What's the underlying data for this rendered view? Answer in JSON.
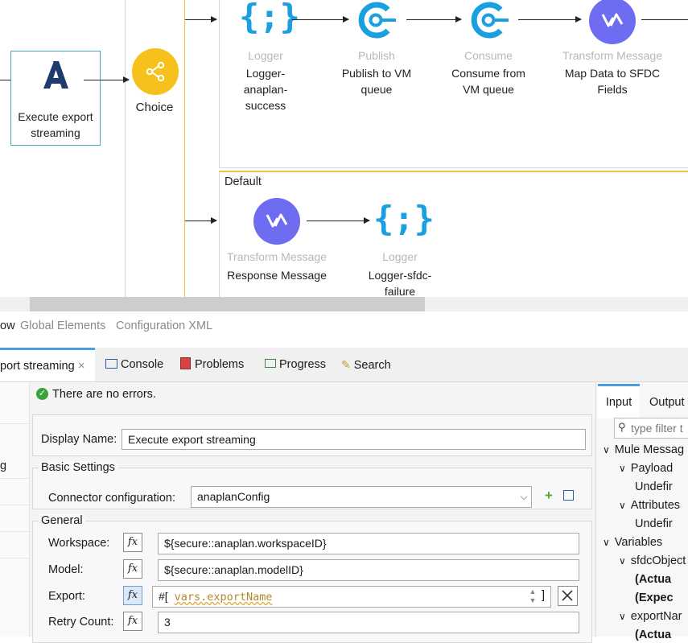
{
  "flow": {
    "source_node": {
      "label": "Execute export streaming"
    },
    "choice_node": {
      "label": "Choice"
    },
    "default_route": {
      "label": "Default"
    },
    "route1": [
      {
        "type": "Logger",
        "label": "Logger-anaplan-success"
      },
      {
        "type": "Publish",
        "label": "Publish to VM queue"
      },
      {
        "type": "Consume",
        "label": "Consume from VM queue"
      },
      {
        "type": "Transform Message",
        "label": "Map Data to SFDC Fields"
      }
    ],
    "route2": [
      {
        "type": "Transform Message",
        "label": "Response Message"
      },
      {
        "type": "Logger",
        "label": "Logger-sfdc-failure"
      }
    ],
    "icons": {
      "logger": "{;}",
      "accent_blue": "#1a9fe0",
      "accent_purple": "#6e6cf0",
      "accent_yellow": "#f5c11a",
      "anaplan_navy": "#1f3a6e"
    }
  },
  "editor_tabs": [
    "ow",
    "Global Elements",
    "Configuration XML"
  ],
  "view_tabs": {
    "active": "port streaming",
    "close": "×",
    "items": [
      "Console",
      "Problems",
      "Progress",
      "Search"
    ]
  },
  "left_stub": {
    "item": "g"
  },
  "props": {
    "status": "There are no errors.",
    "display_name_label": "Display Name:",
    "display_name_value": "Execute export streaming",
    "basic_settings_label": "Basic Settings",
    "connector_label": "Connector configuration:",
    "connector_value": "anaplanConfig",
    "general_label": "General",
    "fields": [
      {
        "label": "Workspace:",
        "value": "${secure::anaplan.workspaceID}"
      },
      {
        "label": "Model:",
        "value": "${secure::anaplan.modelID}"
      },
      {
        "label": "Export:",
        "prefix": "#[",
        "expr": "vars.exportName",
        "suffix": "]"
      },
      {
        "label": "Retry Count:",
        "value": "3"
      }
    ],
    "fx": "fx"
  },
  "metadata": {
    "tabs": [
      "Input",
      "Output"
    ],
    "filter_placeholder": "type filter t",
    "tree": [
      {
        "text": "Mule Messag",
        "indent": 0,
        "arrow": "∨",
        "bold": false
      },
      {
        "text": "Payload",
        "indent": 1,
        "arrow": "∨",
        "bold": false
      },
      {
        "text": "Undefir",
        "indent": 2,
        "arrow": "",
        "bold": false
      },
      {
        "text": "Attributes",
        "indent": 1,
        "arrow": "∨",
        "bold": false
      },
      {
        "text": "Undefir",
        "indent": 2,
        "arrow": "",
        "bold": false
      },
      {
        "text": "Variables",
        "indent": 0,
        "arrow": "∨",
        "bold": false
      },
      {
        "text": "sfdcObject",
        "indent": 1,
        "arrow": "∨",
        "bold": false
      },
      {
        "text": "(Actua",
        "indent": 2,
        "arrow": "",
        "bold": true
      },
      {
        "text": "(Expec",
        "indent": 2,
        "arrow": "",
        "bold": true
      },
      {
        "text": "exportNar",
        "indent": 1,
        "arrow": "∨",
        "bold": false
      },
      {
        "text": "(Actua",
        "indent": 2,
        "arrow": "",
        "bold": true
      }
    ]
  }
}
